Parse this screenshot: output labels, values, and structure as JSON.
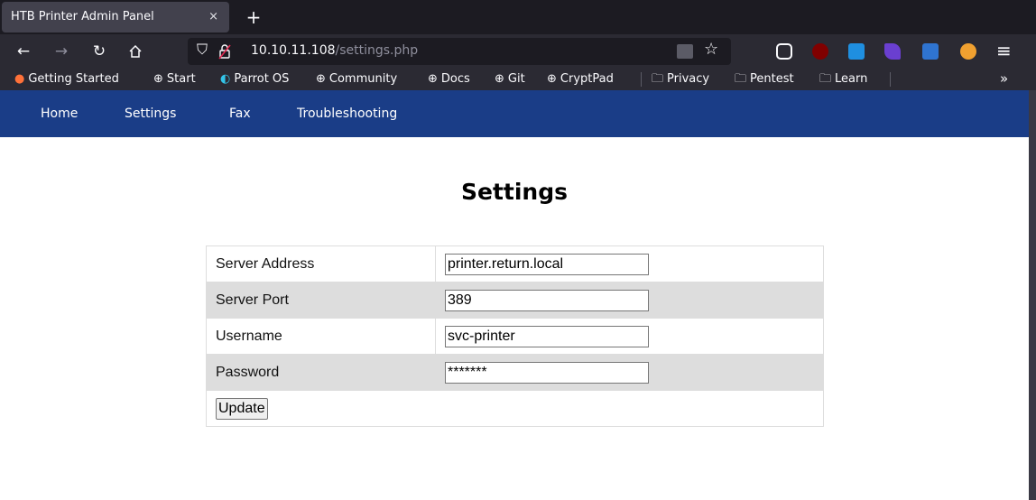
{
  "browser": {
    "tab_title": "HTB Printer Admin Panel",
    "tab_close": "×",
    "new_tab": "+",
    "url_host": "10.10.11.108",
    "url_path": "/settings.php",
    "bookmarks": [
      {
        "label": "Getting Started",
        "icon": "firefox-icon"
      },
      {
        "label": "Start",
        "icon": "globe-icon"
      },
      {
        "label": "Parrot OS",
        "icon": "parrot-icon"
      },
      {
        "label": "Community",
        "icon": "globe-icon"
      },
      {
        "label": "Docs",
        "icon": "globe-icon"
      },
      {
        "label": "Git",
        "icon": "globe-icon"
      },
      {
        "label": "CryptPad",
        "icon": "globe-icon"
      },
      {
        "label": "Privacy",
        "icon": "folder-icon"
      },
      {
        "label": "Pentest",
        "icon": "folder-icon"
      },
      {
        "label": "Learn",
        "icon": "folder-icon"
      }
    ],
    "colors": {
      "tabbar": "#1c1b22",
      "toolbar": "#2b2a33"
    }
  },
  "site": {
    "nav": [
      "Home",
      "Settings",
      "Fax",
      "Troubleshooting"
    ],
    "nav_color": "#1a3d87",
    "title": "Settings",
    "form": {
      "fields": [
        {
          "label": "Server Address",
          "value": "printer.return.local"
        },
        {
          "label": "Server Port",
          "value": "389"
        },
        {
          "label": "Username",
          "value": "svc-printer"
        },
        {
          "label": "Password",
          "value": "*******"
        }
      ],
      "submit_label": "Update"
    }
  }
}
